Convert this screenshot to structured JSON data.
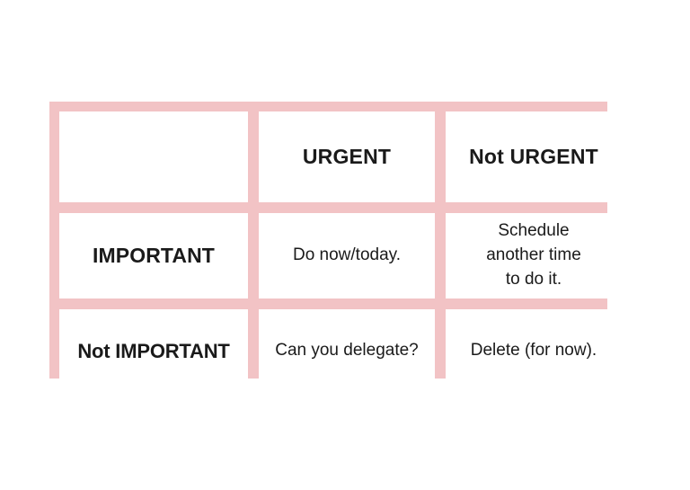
{
  "diagram": {
    "type": "eisenhower-matrix",
    "colors": {
      "grid": "#f2c3c5",
      "cell_background": "#ffffff",
      "text": "#1a1a1a",
      "page_background": "#ffffff"
    },
    "corner_cell": {
      "label": ""
    },
    "column_headers": [
      {
        "id": "urgent",
        "label": "URGENT"
      },
      {
        "id": "not-urgent",
        "label": "Not URGENT"
      }
    ],
    "row_headers": [
      {
        "id": "important",
        "label": "IMPORTANT"
      },
      {
        "id": "not-important",
        "label": "Not IMPORTANT"
      }
    ],
    "cells": [
      {
        "id": "important-urgent",
        "row": "IMPORTANT",
        "column": "URGENT",
        "text": "Do now/today."
      },
      {
        "id": "important-not-urgent",
        "row": "IMPORTANT",
        "column": "Not URGENT",
        "text": "Schedule\nanother time\nto do it."
      },
      {
        "id": "not-important-urgent",
        "row": "Not IMPORTANT",
        "column": "URGENT",
        "text": "Can you delegate?"
      },
      {
        "id": "not-important-not-urgent",
        "row": "Not IMPORTANT",
        "column": "Not URGENT",
        "text": "Delete (for now)."
      }
    ]
  }
}
